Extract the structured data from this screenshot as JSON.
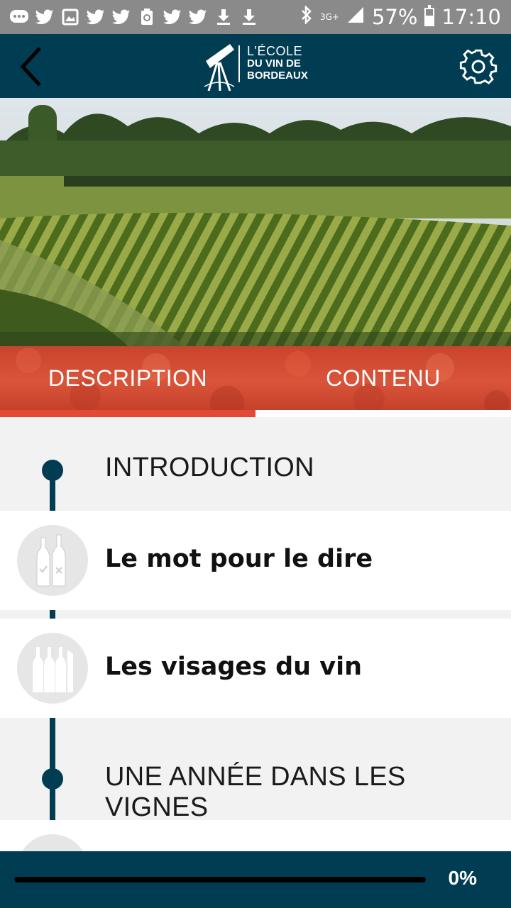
{
  "status_bar": {
    "notification_icons": [
      "chat-icon",
      "twitter-icon",
      "image-icon",
      "twitter-icon",
      "twitter-icon",
      "recycle-icon",
      "twitter-icon",
      "twitter-icon",
      "download-icon",
      "download-icon"
    ],
    "network": "3G+",
    "battery_percent": "57%",
    "battery_level": 0.57,
    "time": "17:10"
  },
  "app_bar": {
    "logo_line1": "L'ÉCOLE",
    "logo_line2": "DU VIN DE",
    "logo_line3": "BORDEAUX",
    "back_icon": "chevron-left-icon",
    "settings_icon": "gear-icon"
  },
  "tabs": [
    {
      "label": "DESCRIPTION",
      "active": true
    },
    {
      "label": "CONTENU",
      "active": false
    }
  ],
  "list": {
    "section_1": "INTRODUCTION",
    "item_1": "Le mot pour le dire",
    "item_2": "Les visages du vin",
    "section_2": "UNE ANNÉE DANS LES VIGNES"
  },
  "progress": {
    "label": "0%",
    "value": 0
  },
  "colors": {
    "primary": "#003d52",
    "accent": "#e34a35",
    "tabs_bg": "#c8442c"
  }
}
